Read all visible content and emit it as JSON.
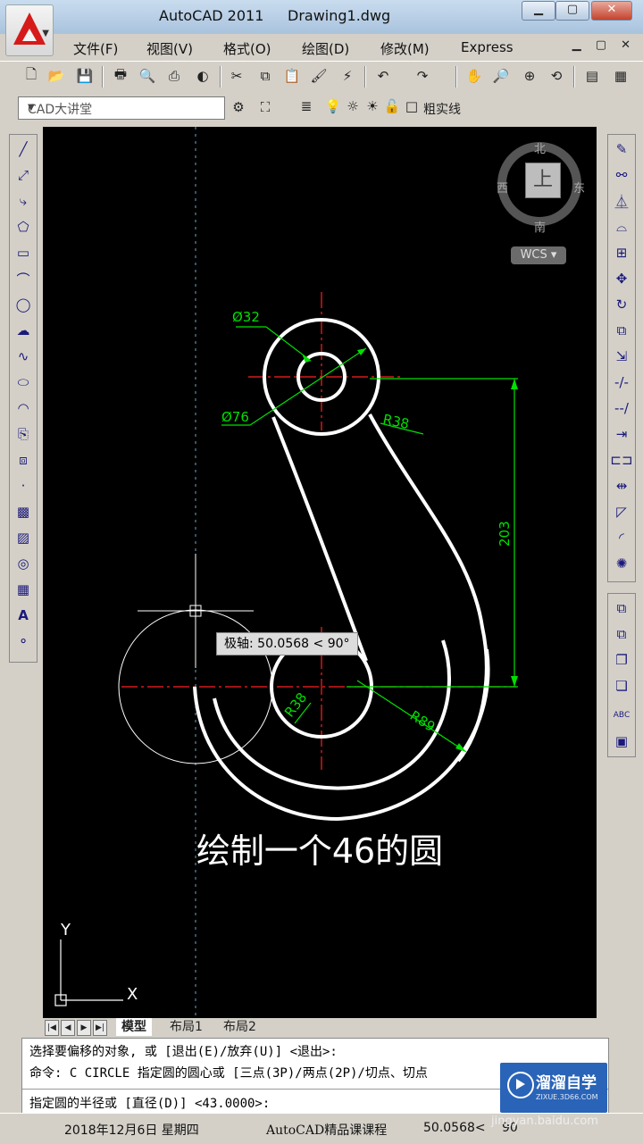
{
  "window": {
    "app_title": "AutoCAD 2011",
    "file_title": "Drawing1.dwg",
    "min": "▁",
    "max": "▢",
    "close": "✕"
  },
  "menu": [
    "文件(F)",
    "视图(V)",
    "格式(O)",
    "绘图(D)",
    "修改(M)",
    "Express"
  ],
  "mdi_controls": "▁ ▢ ✕",
  "toolbar2": {
    "text_style": "CAD大讲堂",
    "layer": "粗实线"
  },
  "viewcube": {
    "north": "北",
    "south": "南",
    "east": "东",
    "west": "西",
    "top_face": "上",
    "wcs": "WCS"
  },
  "dimensions": {
    "d1": "Ø32",
    "d2": "Ø76",
    "r1": "R38",
    "r2": "R38",
    "r3": "R89",
    "len": "203"
  },
  "polar_tooltip": "极轴: 50.0568 < 90°",
  "subtitle": "绘制一个46的圆",
  "ucs": {
    "x": "X",
    "y": "Y"
  },
  "tabs": {
    "model": "模型",
    "layout1": "布局1",
    "layout2": "布局2"
  },
  "command": {
    "line1": "选择要偏移的对象, 或 [退出(E)/放弃(U)] <退出>:",
    "line2": "命令: C CIRCLE 指定圆的圆心或 [三点(3P)/两点(2P)/切点、切点",
    "prompt": "指定圆的半径或 [直径(D)] <43.0000>:"
  },
  "status": {
    "date": "2018年12月6日 星期四",
    "course": "AutoCAD精品课课程",
    "coord": "50.0568<",
    "mode": "90"
  },
  "watermark": {
    "name": "溜溜自学",
    "sub": "ZIXUE.3D66.COM",
    "url": "jingyan.baidu.com"
  }
}
